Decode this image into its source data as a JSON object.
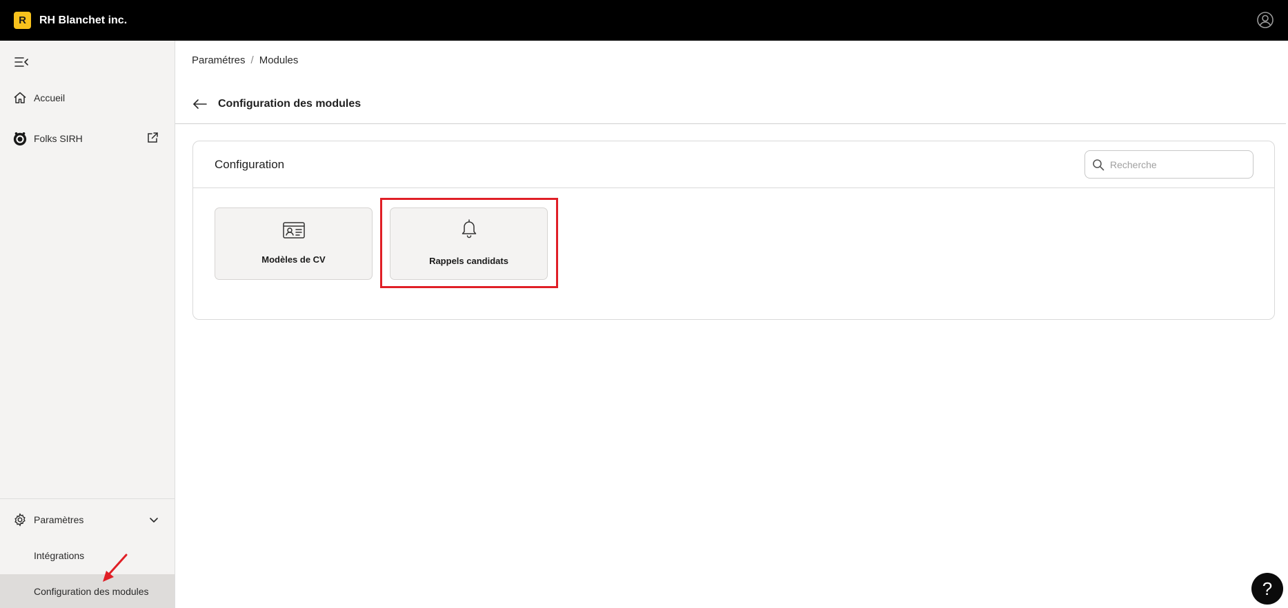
{
  "app": {
    "logo_letter": "R",
    "name": "RH Blanchet inc."
  },
  "sidebar": {
    "items": [
      {
        "label": "Accueil"
      },
      {
        "label": "Folks SIRH"
      }
    ],
    "settings": {
      "label": "Paramètres",
      "subitems": [
        {
          "label": "Intégrations"
        },
        {
          "label": "Configuration des modules"
        }
      ]
    }
  },
  "breadcrumb": {
    "parent": "Paramétres",
    "separator": "/",
    "current": "Modules"
  },
  "page": {
    "title": "Configuration des modules"
  },
  "panel": {
    "title": "Configuration",
    "search_placeholder": "Recherche",
    "cards": [
      {
        "label": "Modèles de CV",
        "icon": "id-card-icon"
      },
      {
        "label": "Rappels candidats",
        "icon": "bell-icon"
      }
    ]
  },
  "help": {
    "label": "?"
  },
  "colors": {
    "brand": "#f8c21d",
    "highlight": "#e01f26",
    "topbar": "#000000"
  }
}
